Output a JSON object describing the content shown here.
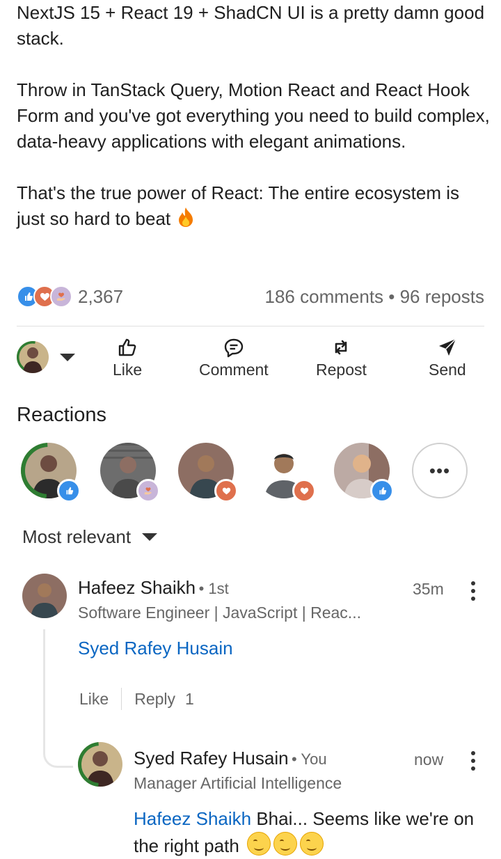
{
  "post": {
    "para1": "NextJS 15 + React 19 + ShadCN UI is a pretty damn good stack.",
    "para2": "Throw in TanStack Query, Motion React and React Hook Form and you've got everything you need to build complex, data-heavy applications with elegant animations.",
    "para3": "That's the true power of React: The entire ecosystem is just so hard to beat",
    "emoji": "fire-emoji"
  },
  "stats": {
    "reaction_count": "2,367",
    "comments_reposts": "186 comments • 96 reposts",
    "reaction_icons": [
      "like-reaction-icon",
      "love-reaction-icon",
      "support-reaction-icon"
    ]
  },
  "actions": {
    "like": "Like",
    "comment": "Comment",
    "repost": "Repost",
    "send": "Send"
  },
  "reactions": {
    "title": "Reactions",
    "more": "•••",
    "people": [
      {
        "bg": "#2e7d32",
        "badge": "like"
      },
      {
        "bg": "#6d6d6d",
        "badge": "support"
      },
      {
        "bg": "#8d6e63",
        "badge": "love"
      },
      {
        "bg": "#ffffff",
        "badge": "love"
      },
      {
        "bg": "#a1887f",
        "badge": "like"
      }
    ]
  },
  "sort": {
    "label": "Most relevant"
  },
  "comments": [
    {
      "name": "Hafeez Shaikh",
      "degree": "• 1st",
      "headline": "Software Engineer | JavaScript | Reac...",
      "time": "35m",
      "mention": "Syed Rafey Husain",
      "text": "",
      "like": "Like",
      "reply": "Reply",
      "reply_count": "1"
    },
    {
      "name": "Syed Rafey Husain",
      "degree": "• You",
      "headline": "Manager Artificial Intelligence",
      "time": "now",
      "mention": "Hafeez Shaikh",
      "text": " Bhai... Seems like we're on the right path"
    }
  ],
  "colors": {
    "link": "#0a66c2",
    "like_badge": "#378fe9",
    "love_badge": "#df704d",
    "support_badge": "#c8b5d9"
  }
}
